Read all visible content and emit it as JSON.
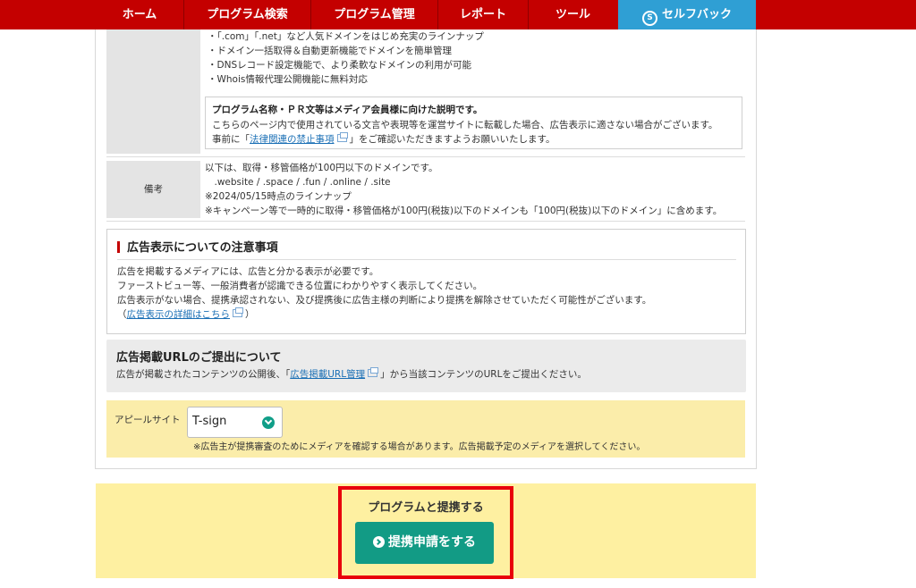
{
  "nav": {
    "items": [
      "ホーム",
      "プログラム検索",
      "プログラム管理",
      "レポート",
      "ツール"
    ],
    "selfback_label": "セルフバック",
    "selfback_icon": "S"
  },
  "features": [
    "・「.com」「.net」など人気ドメインをはじめ充実のラインナップ",
    "・ドメイン一括取得＆自動更新機能でドメインを簡単管理",
    "・DNSレコード設定機能で、より柔軟なドメインの利用が可能",
    "・Whois情報代理公開機能に無料対応"
  ],
  "pr_notice": {
    "title": "プログラム名称・ＰＲ文等はメディア会員様に向けた説明です。",
    "line1": "こちらのページ内で使用されている文言や表現等を運営サイトに転載した場合、広告表示に適さない場合がございます。",
    "line2_pre": "事前に「",
    "line2_link": "法律関連の禁止事項",
    "line2_post": "」をご確認いただきますようお願いいたします。"
  },
  "remarks": {
    "label": "備考",
    "lines": [
      "以下は、取得・移管価格が100円以下のドメインです。",
      "　.website / .space / .fun / .online / .site",
      "※2024/05/15時点のラインナップ",
      "※キャンペーン等で一時的に取得・移管価格が100円(税抜)以下のドメインも「100円(税抜)以下のドメイン」に含めます。"
    ]
  },
  "ad_notice": {
    "title": "広告表示についての注意事項",
    "lines": [
      "広告を掲載するメディアには、広告と分かる表示が必要です。",
      "ファーストビュー等、一般消費者が認識できる位置にわかりやすく表示してください。",
      "広告表示がない場合、提携承認されない、及び提携後に広告主様の判断により提携を解除させていただく可能性がございます。"
    ],
    "link_pre": "（",
    "link": "広告表示の詳細はこちら",
    "link_post": "）"
  },
  "url_submit": {
    "title": "広告掲載URLのご提出について",
    "text_pre": "広告が掲載されたコンテンツの公開後、「",
    "link": "広告掲載URL管理",
    "text_post": "」から当該コンテンツのURLをご提出ください。"
  },
  "appeal": {
    "label": "アピールサイト",
    "selected": "T-sign",
    "note": "※広告主が提携審査のためにメディアを確認する場合があります。広告掲載予定のメディアを選択してください。"
  },
  "cta": {
    "title": "プログラムと提携する",
    "button": "提携申請をする"
  },
  "colors": {
    "nav_red": "#c40000",
    "selfback_blue": "#2f9fd4",
    "cta_green": "#129b85",
    "highlight_red": "#e8000b",
    "appeal_yellow": "#fbedaa"
  }
}
